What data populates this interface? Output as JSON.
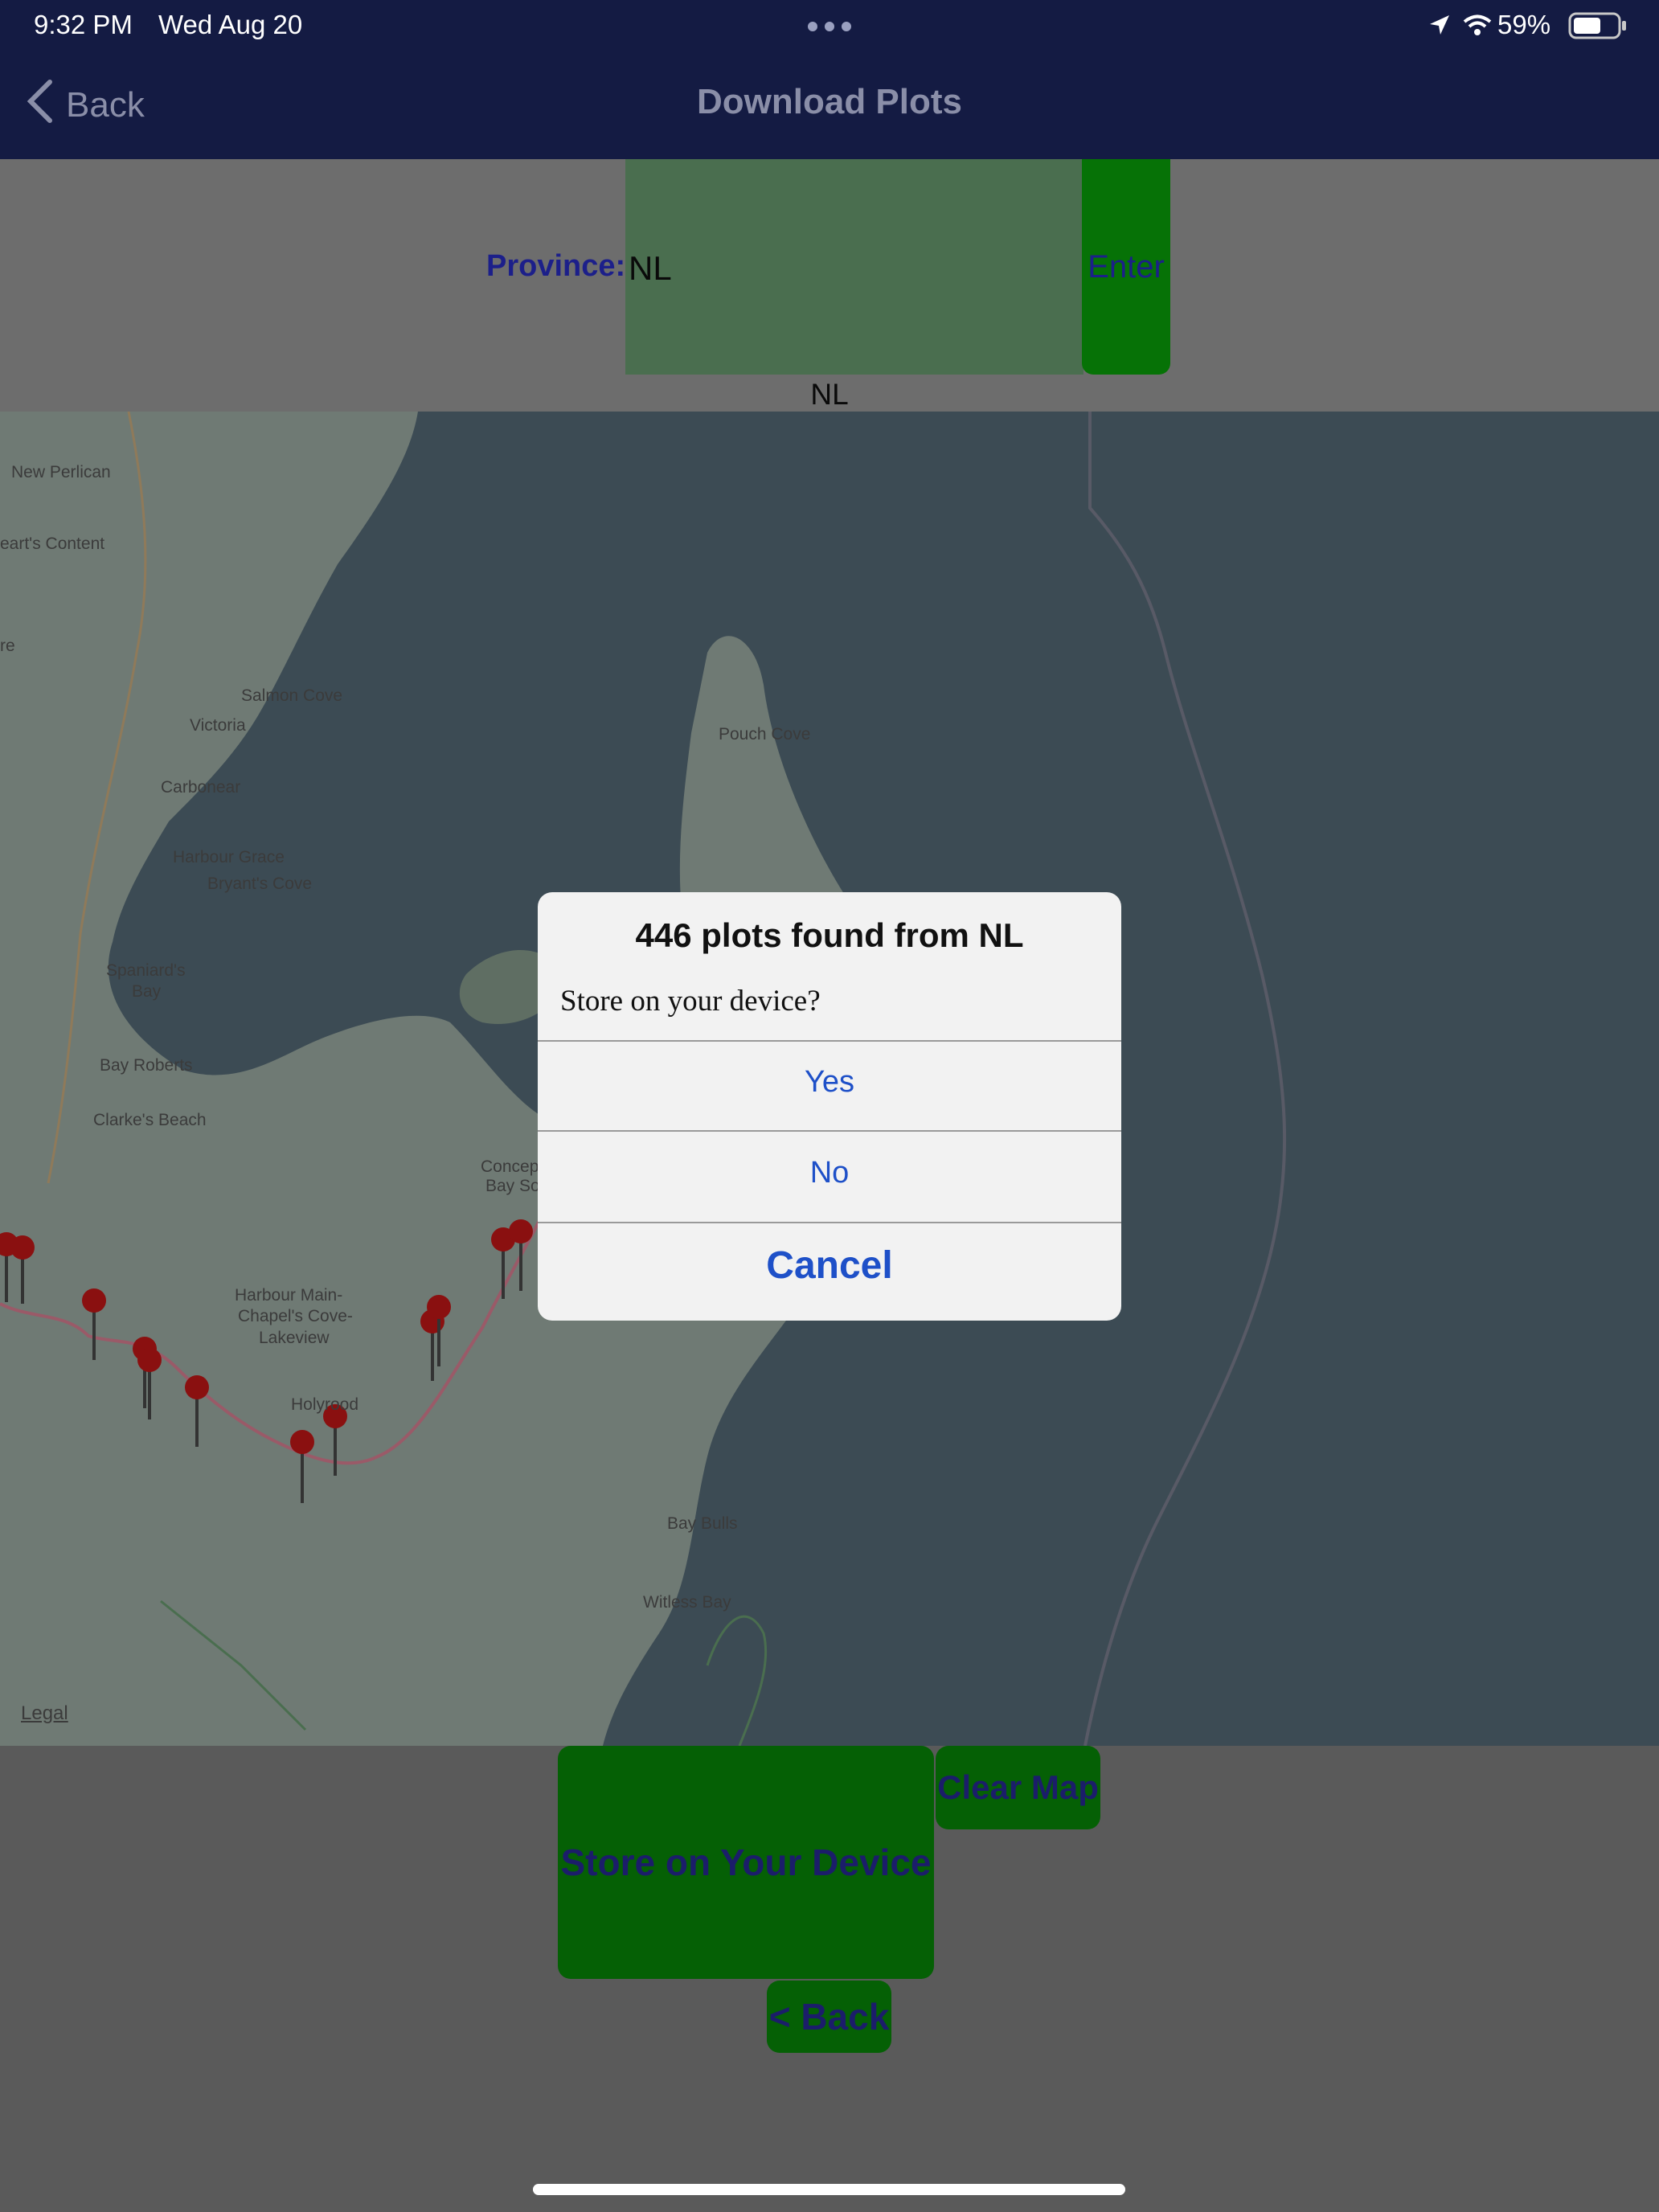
{
  "status_bar": {
    "time": "9:32 PM",
    "date": "Wed Aug 20",
    "battery": "59%"
  },
  "nav": {
    "back_label": "Back",
    "title": "Download Plots"
  },
  "province": {
    "label": "Province:",
    "input_value": "NL",
    "enter_label": "Enter",
    "selected_value": "NL"
  },
  "map": {
    "labels": [
      "New Perlican",
      "eart's Content",
      "re",
      "Salmon Cove",
      "Victoria",
      "Carbonear",
      "Harbour Grace",
      "Bryant's Cove",
      "Spaniard's",
      "Bay",
      "Bay Roberts",
      "Clarke's Beach",
      "Pouch Cove",
      "Concep",
      "Bay So",
      "Harbour Main-",
      "Chapel's Cove-",
      "Lakeview",
      "Holyrood",
      "Bay Bulls",
      "Witless Bay"
    ],
    "legal_label": "Legal",
    "pin_count": 14
  },
  "dialog": {
    "title": "446 plots found from NL",
    "message": "Store on your device?",
    "yes": "Yes",
    "no": "No",
    "cancel": "Cancel"
  },
  "bottom": {
    "store_label": "Store on Your Device",
    "clear_label": "Clear Map",
    "back_label": "< Back"
  }
}
